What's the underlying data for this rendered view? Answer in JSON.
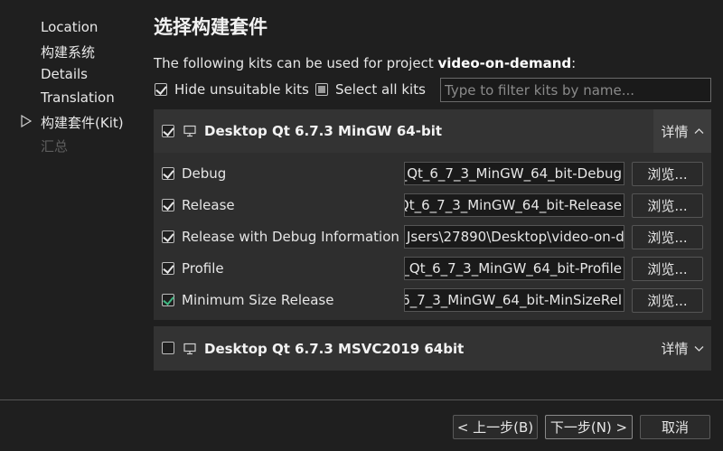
{
  "sidebar": {
    "items": [
      {
        "label": "Location",
        "state": "done"
      },
      {
        "label": "构建系统",
        "state": "done"
      },
      {
        "label": "Details",
        "state": "done"
      },
      {
        "label": "Translation",
        "state": "done"
      },
      {
        "label": "构建套件(Kit)",
        "state": "current"
      },
      {
        "label": "汇总",
        "state": "pending"
      }
    ]
  },
  "header": {
    "title": "选择构建套件",
    "subtitle_prefix": "The following kits can be used for project ",
    "project_name": "video-on-demand",
    "subtitle_suffix": ":"
  },
  "filters": {
    "hide_unsuitable_label": "Hide unsuitable kits",
    "hide_unsuitable_checked": true,
    "select_all_label": "Select all kits",
    "select_all_state": "partial",
    "filter_placeholder": "Type to filter kits by name..."
  },
  "kits": [
    {
      "name": "Desktop Qt 6.7.3 MinGW 64-bit",
      "checked": true,
      "expanded": true,
      "details_label": "详情",
      "builds": [
        {
          "label": "Debug",
          "checked": true,
          "path_visible": "_Qt_6_7_3_MinGW_64_bit-Debug",
          "browse_label": "浏览..."
        },
        {
          "label": "Release",
          "checked": true,
          "path_visible": "Qt_6_7_3_MinGW_64_bit-Release",
          "browse_label": "浏览..."
        },
        {
          "label": "Release with Debug Information",
          "checked": true,
          "path_visible": "Jsers\\27890\\Desktop\\video-on-de",
          "browse_label": "浏览..."
        },
        {
          "label": "Profile",
          "checked": true,
          "path_visible": "_Qt_6_7_3_MinGW_64_bit-Profile",
          "browse_label": "浏览..."
        },
        {
          "label": "Minimum Size Release",
          "checked": true,
          "path_visible": "6_7_3_MinGW_64_bit-MinSizeRel",
          "browse_label": "浏览..."
        }
      ]
    },
    {
      "name": "Desktop Qt 6.7.3 MSVC2019 64bit",
      "checked": false,
      "expanded": false,
      "details_label": "详情"
    }
  ],
  "footer": {
    "back_label": "< 上一步(B)",
    "next_label": "下一步(N) >",
    "cancel_label": "取消"
  },
  "colors": {
    "background": "#1f1f1f",
    "panel": "#2e2e2e",
    "check_green": "#41b883"
  }
}
